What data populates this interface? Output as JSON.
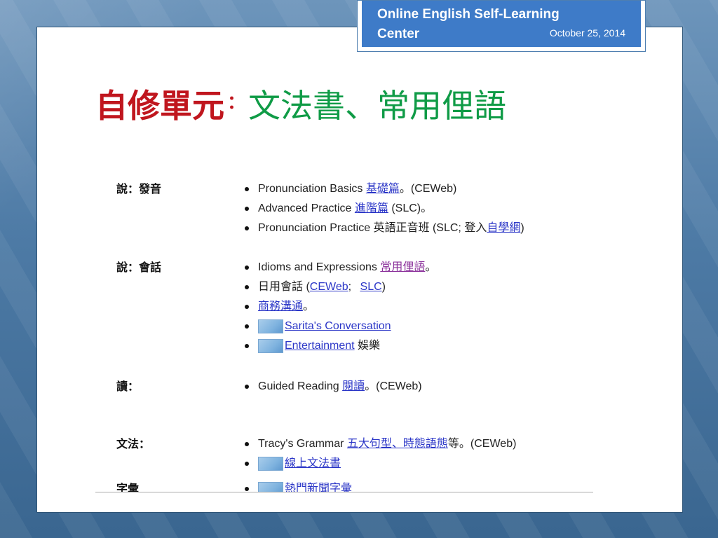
{
  "header": {
    "title": "Online English Self-Learning Center",
    "date": "October 25, 2014"
  },
  "slide_title": {
    "red": "自修單元",
    "colon": "：",
    "green": "文法書、常用俚語"
  },
  "sections": {
    "speaking_pronunciation": {
      "label": "說：發音",
      "items": [
        {
          "pre": "Pronunciation Basics ",
          "link": "基礎篇",
          "post": "。(CEWeb)"
        },
        {
          "pre": "Advanced Practice ",
          "link": "進階篇",
          "post": " (SLC)。"
        },
        {
          "pre": "Pronunciation Practice 英語正音班 (SLC; 登入",
          "link": "自學網",
          "post": ")"
        }
      ]
    },
    "speaking_conversation": {
      "label": "說：會話",
      "items": [
        {
          "pre": "Idioms and Expressions ",
          "link": "常用俚語",
          "post": "。"
        },
        {
          "pre": "日用會話 (",
          "link": "CEWeb",
          "mid": "; ",
          "link2": "SLC",
          "post": ")"
        },
        {
          "link": "商務溝通",
          "post": "。"
        },
        {
          "link": "Sarita's Conversation"
        },
        {
          "link": "Entertainment",
          "post": " 娛樂"
        }
      ]
    },
    "reading": {
      "label": "讀：",
      "items": [
        {
          "pre": "Guided Reading ",
          "link": "閱讀",
          "post": "。(CEWeb)"
        }
      ]
    },
    "grammar": {
      "label": "文法：",
      "items": [
        {
          "pre": "Tracy's Grammar ",
          "link": "五大句型、時態語態",
          "post": "等。(CEWeb)"
        },
        {
          "link": "線上文法書"
        }
      ]
    },
    "vocabulary": {
      "label": "字彙",
      "items": [
        {
          "link": "熱門新聞字彙"
        }
      ]
    }
  },
  "colors": {
    "title_red": "#c0161e",
    "title_green": "#0f9b46",
    "header_blue": "#3e7bc8",
    "link_blue": "#2b36c7",
    "link_visited": "#8a2f9a"
  }
}
